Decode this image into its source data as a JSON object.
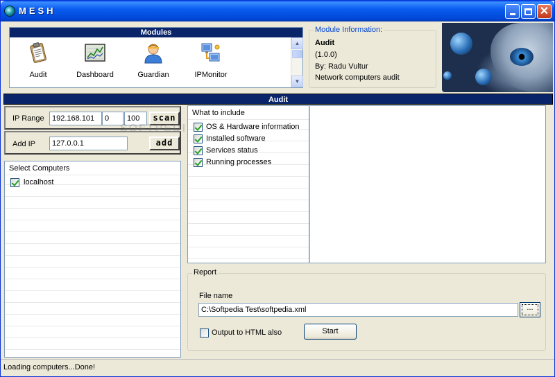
{
  "window": {
    "title": "MESH",
    "buttons": [
      "minimize",
      "maximize",
      "close"
    ]
  },
  "modules": {
    "header": "Modules",
    "items": [
      {
        "label": "Audit",
        "icon": "clipboard-icon"
      },
      {
        "label": "Dashboard",
        "icon": "chart-icon"
      },
      {
        "label": "Guardian",
        "icon": "user-icon"
      },
      {
        "label": "IPMonitor",
        "icon": "network-icon"
      }
    ]
  },
  "module_info": {
    "legend": "Module Information:",
    "name": "Audit",
    "version": "(1.0.0)",
    "author": "By: Radu Vultur",
    "description": "Network computers audit"
  },
  "audit": {
    "header": "Audit",
    "ip_range": {
      "label": "IP Range",
      "ip": "192.168.101",
      "from": "0",
      "to": "100",
      "button": "scan"
    },
    "add_ip": {
      "label": "Add IP",
      "value": "127.0.0.1",
      "button": "add"
    },
    "computers": {
      "header": "Select Computers",
      "items": [
        {
          "label": "localhost",
          "checked": true
        }
      ]
    },
    "include": {
      "header": "What to include",
      "items": [
        {
          "label": "OS & Hardware information",
          "checked": true
        },
        {
          "label": "Installed software",
          "checked": true
        },
        {
          "label": "Services status",
          "checked": true
        },
        {
          "label": "Running processes",
          "checked": true
        }
      ]
    },
    "report": {
      "legend": "Report",
      "file_label": "File name",
      "file_value": "C:\\Softpedia Test\\softpedia.xml",
      "browse_label": "...",
      "html_label": "Output to HTML also",
      "html_checked": false,
      "start_label": "Start"
    }
  },
  "status": {
    "text": "Loading computers...Done!"
  },
  "watermark": "SOFTPEDIA",
  "colors": {
    "title_bar": "#0054e3",
    "header_bar": "#0a246a",
    "window_bg": "#ece9d8"
  }
}
